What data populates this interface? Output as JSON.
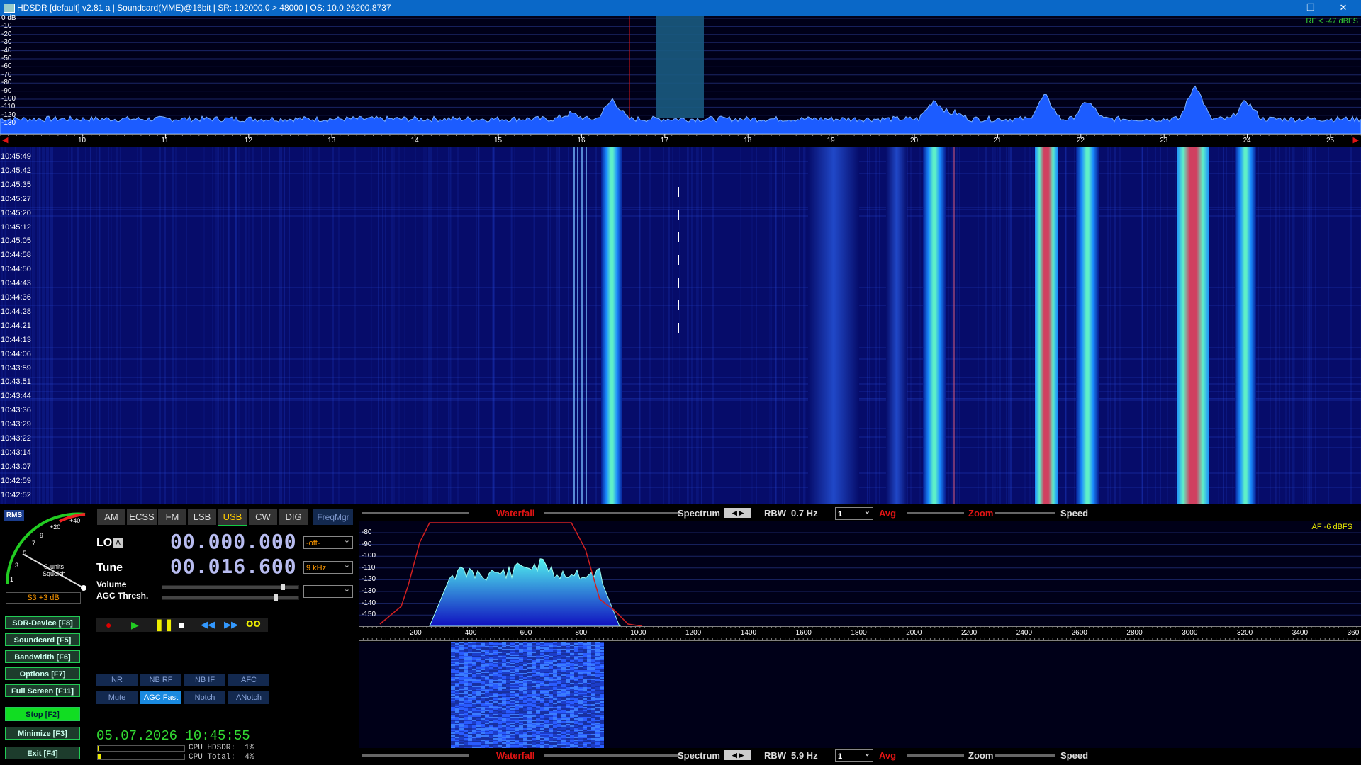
{
  "window": {
    "title": "HDSDR  [default]  v2.81 a  |  Soundcard(MME)@16bit  |  SR: 192000.0 > 48000  |  OS: 10.0.26200.8737",
    "controls": [
      "–",
      "❐",
      "✕"
    ]
  },
  "rf_spectrum": {
    "db_labels": [
      "0 dB",
      "-10",
      "-20",
      "-30",
      "-40",
      "-50",
      "-60",
      "-70",
      "-80",
      "-90",
      "-100",
      "-110",
      "-120",
      "-130"
    ],
    "rf_level": "RF < -47 dBFS",
    "freq_ticks": [
      "10",
      "11",
      "12",
      "13",
      "14",
      "15",
      "16",
      "17",
      "18",
      "19",
      "20",
      "21",
      "22",
      "23",
      "24",
      "25"
    ]
  },
  "waterfall": {
    "timestamps": [
      "10:45:49",
      "10:45:42",
      "10:45:35",
      "10:45:27",
      "10:45:20",
      "10:45:12",
      "10:45:05",
      "10:44:58",
      "10:44:50",
      "10:44:43",
      "10:44:36",
      "10:44:28",
      "10:44:21",
      "10:44:13",
      "10:44:06",
      "10:43:59",
      "10:43:51",
      "10:43:44",
      "10:43:36",
      "10:43:29",
      "10:43:22",
      "10:43:14",
      "10:43:07",
      "10:42:59",
      "10:42:52"
    ]
  },
  "smeter": {
    "mode_label": "RMS",
    "scale": [
      "1",
      "3",
      "5",
      "7",
      "9",
      "+20",
      "+40"
    ],
    "caption1": "S-units",
    "caption2": "Squelch",
    "reading": "S3 +3 dB"
  },
  "modes": {
    "items": [
      "AM",
      "ECSS",
      "FM",
      "LSB",
      "USB",
      "CW",
      "DIG"
    ],
    "active": "USB",
    "freqmgr": "FreqMgr"
  },
  "lo": {
    "label": "LO",
    "tag": "A",
    "value": "00.000.000",
    "select": "-off-"
  },
  "tune": {
    "label": "Tune",
    "value": "00.016.600",
    "select": "9 kHz"
  },
  "sliders": {
    "volume": "Volume",
    "agc": "AGC Thresh."
  },
  "transport": [
    "record",
    "play",
    "pause",
    "stop",
    "rewind",
    "fast-forward",
    "loop"
  ],
  "side_buttons": [
    {
      "label": "SDR-Device [F8]",
      "active": false
    },
    {
      "label": "Soundcard  [F5]",
      "active": false
    },
    {
      "label": "Bandwidth  [F6]",
      "active": false
    },
    {
      "label": "Options  [F7]",
      "active": false
    },
    {
      "label": "Full Screen  [F11]",
      "active": false
    },
    {
      "label": "Stop          [F2]",
      "active": true
    },
    {
      "label": "Minimize  [F3]",
      "active": false
    },
    {
      "label": "Exit          [F4]",
      "active": false
    }
  ],
  "dsp": {
    "row1": [
      "NR",
      "NB RF",
      "NB IF",
      "AFC"
    ],
    "row2": [
      "Mute",
      "AGC Fast",
      "Notch",
      "ANotch"
    ],
    "active": "AGC Fast"
  },
  "datetime": "05.07.2026 10:45:55",
  "cpu": {
    "hdsdr": "CPU HDSDR:  1%",
    "total": "CPU Total:  4%",
    "hdsdr_fraction": 0.01,
    "total_fraction": 0.04
  },
  "toolbar_top": {
    "waterfall": "Waterfall",
    "spectrum": "Spectrum",
    "rbw_label": "RBW",
    "rbw_value": "0.7 Hz",
    "avg_value": "1",
    "avg": "Avg",
    "zoom": "Zoom",
    "speed": "Speed"
  },
  "toolbar_bottom": {
    "waterfall": "Waterfall",
    "spectrum": "Spectrum",
    "rbw_label": "RBW",
    "rbw_value": "5.9 Hz",
    "avg_value": "1",
    "avg": "Avg",
    "zoom": "Zoom",
    "speed": "Speed"
  },
  "af_spectrum": {
    "db_labels": [
      "-80",
      "-90",
      "-100",
      "-110",
      "-120",
      "-130",
      "-140",
      "-150"
    ],
    "af_level": "AF  -6 dBFS",
    "freq_ticks": [
      "200",
      "400",
      "600",
      "800",
      "1000",
      "1200",
      "1400",
      "1600",
      "1800",
      "2000",
      "2200",
      "2400",
      "2600",
      "2800",
      "3000",
      "3200",
      "3400",
      "360"
    ]
  },
  "colors": {
    "accent": "#0a68c8",
    "active_button": "#11dd22",
    "usb_active": "#ffcc00",
    "waterfall_bg": "#060c6a",
    "spectrum_fill": "#1c5cff"
  }
}
